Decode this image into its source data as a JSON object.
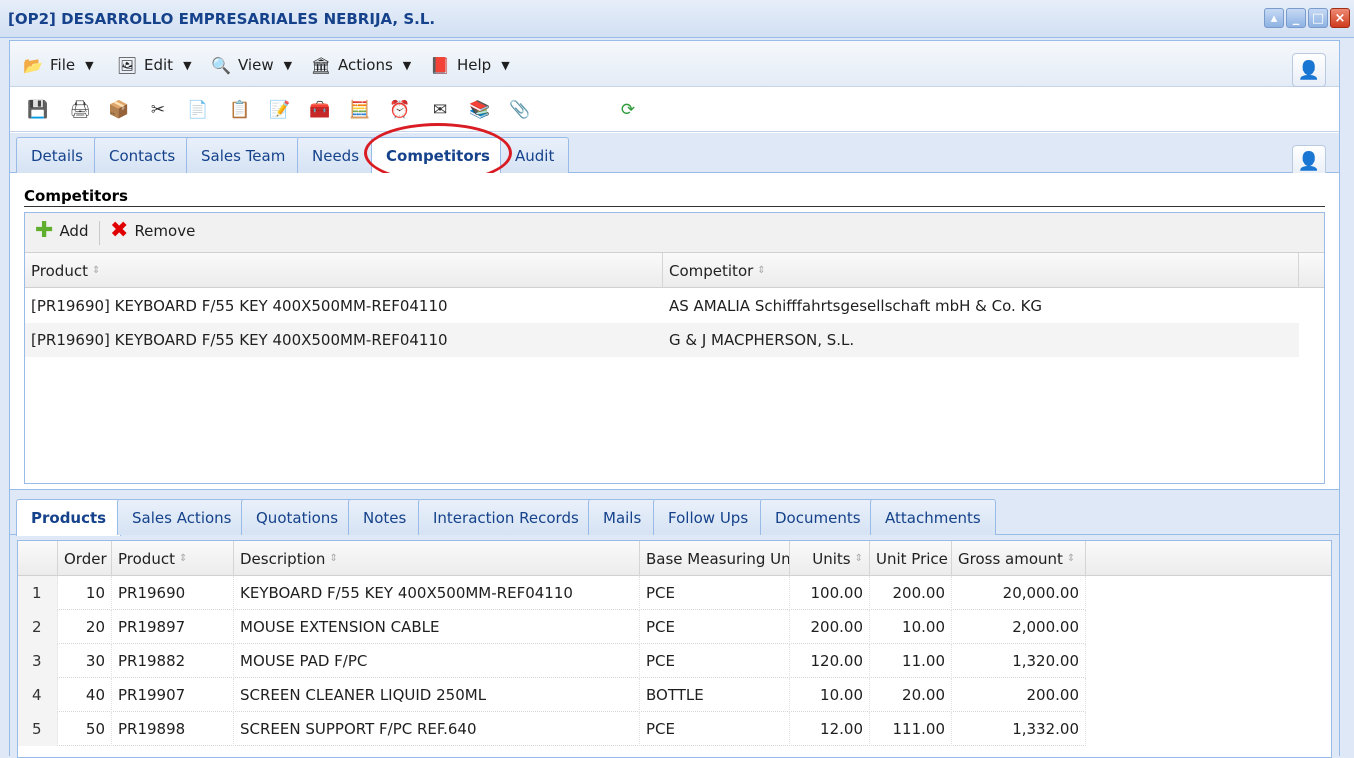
{
  "window": {
    "title": "[OP2] DESARROLLO EMPRESARIALES NEBRIJA, S.L."
  },
  "menu": {
    "items": [
      {
        "label": "File",
        "icon": "file-icon"
      },
      {
        "label": "Edit",
        "icon": "edit-icon"
      },
      {
        "label": "View",
        "icon": "view-icon"
      },
      {
        "label": "Actions",
        "icon": "actions-icon"
      },
      {
        "label": "Help",
        "icon": "help-icon"
      }
    ]
  },
  "toolbar": {
    "icons": [
      "save-icon",
      "print-icon",
      "box-icon",
      "cut-icon",
      "copy-icon",
      "paste-icon",
      "note-icon",
      "toolbox-icon",
      "calculator-icon",
      "alarm-icon",
      "mail-icon",
      "bundle-icon",
      "attach-icon",
      "refresh-icon"
    ]
  },
  "top_tabs": {
    "items": [
      "Details",
      "Contacts",
      "Sales Team",
      "Needs",
      "Competitors",
      "Audit"
    ],
    "active": "Competitors"
  },
  "competitors": {
    "section_title": "Competitors",
    "add_label": "Add",
    "remove_label": "Remove",
    "columns": [
      "Product",
      "Competitor"
    ],
    "rows": [
      {
        "product": "[PR19690] KEYBOARD F/55 KEY 400X500MM-REF04110",
        "competitor": "AS AMALIA Schifffahrtsgesellschaft mbH & Co. KG"
      },
      {
        "product": "[PR19690] KEYBOARD F/55 KEY 400X500MM-REF04110",
        "competitor": "G & J MACPHERSON, S.L."
      }
    ]
  },
  "bottom_tabs": {
    "items": [
      "Products",
      "Sales Actions",
      "Quotations",
      "Notes",
      "Interaction Records",
      "Mails",
      "Follow Ups",
      "Documents",
      "Attachments"
    ],
    "active": "Products"
  },
  "products": {
    "columns": [
      "Order",
      "Product",
      "Description",
      "Base Measuring Unit",
      "Units",
      "Unit Price",
      "Gross amount"
    ],
    "rows": [
      {
        "n": "1",
        "order": "10",
        "product": "PR19690",
        "description": "KEYBOARD F/55 KEY 400X500MM-REF04110",
        "unit": "PCE",
        "units": "100.00",
        "price": "200.00",
        "gross": "20,000.00"
      },
      {
        "n": "2",
        "order": "20",
        "product": "PR19897",
        "description": "MOUSE EXTENSION CABLE",
        "unit": "PCE",
        "units": "200.00",
        "price": "10.00",
        "gross": "2,000.00"
      },
      {
        "n": "3",
        "order": "30",
        "product": "PR19882",
        "description": "MOUSE PAD F/PC",
        "unit": "PCE",
        "units": "120.00",
        "price": "11.00",
        "gross": "1,320.00"
      },
      {
        "n": "4",
        "order": "40",
        "product": "PR19907",
        "description": "SCREEN CLEANER LIQUID 250ML",
        "unit": "BOTTLE",
        "units": "10.00",
        "price": "20.00",
        "gross": "200.00"
      },
      {
        "n": "5",
        "order": "50",
        "product": "PR19898",
        "description": "SCREEN SUPPORT F/PC REF.640",
        "unit": "PCE",
        "units": "12.00",
        "price": "111.00",
        "gross": "1,332.00"
      }
    ]
  }
}
